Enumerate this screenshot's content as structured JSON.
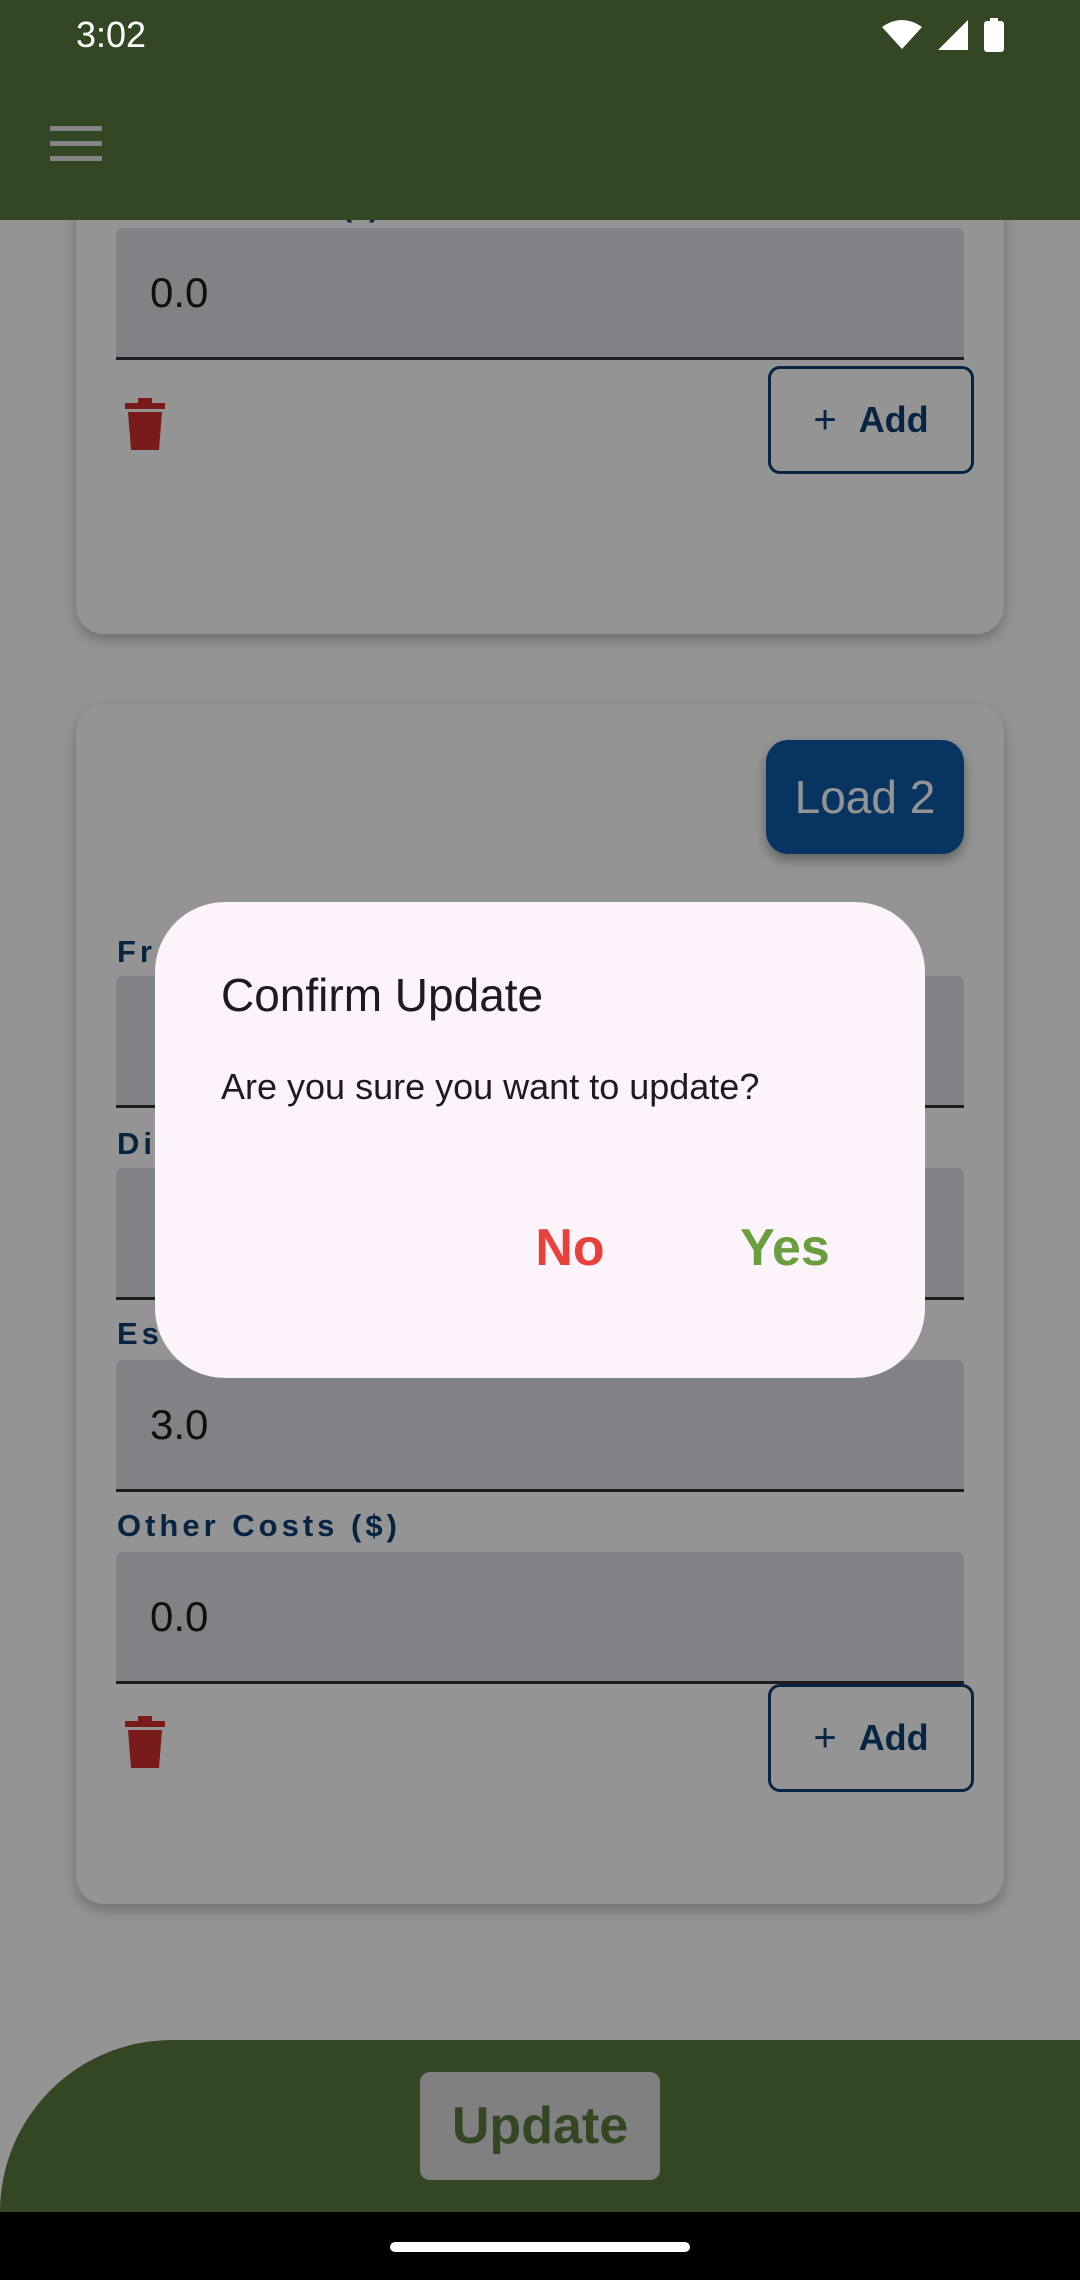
{
  "status_bar": {
    "time": "3:02",
    "icons": [
      "wifi-icon",
      "signal-icon",
      "battery-icon"
    ]
  },
  "app_bar": {
    "menu_icon": "menu-icon",
    "color": "#5a7a40"
  },
  "card_1": {
    "partial_label": "( )",
    "field_value": "0.0",
    "add_label": "Add"
  },
  "card_2": {
    "badge": "Load 2",
    "fields": [
      {
        "label": "Fr",
        "value": ""
      },
      {
        "label": "Di",
        "value": ""
      },
      {
        "label": "Es",
        "value": "3.0"
      },
      {
        "label": "Other Costs ($)",
        "value": "0.0"
      }
    ],
    "add_label": "Add"
  },
  "bottom_bar": {
    "update_label": "Update"
  },
  "dialog": {
    "title": "Confirm Update",
    "message": "Are you sure you want to update?",
    "no_label": "No",
    "yes_label": "Yes"
  },
  "colors": {
    "primary_green": "#5a7a40",
    "navy": "#0d3f74",
    "badge_blue": "#0f5aa8",
    "danger_red": "#e8403a",
    "confirm_green": "#6a9e3f",
    "trash_red": "#d32f2f",
    "dialog_bg": "#fcf3fb"
  }
}
